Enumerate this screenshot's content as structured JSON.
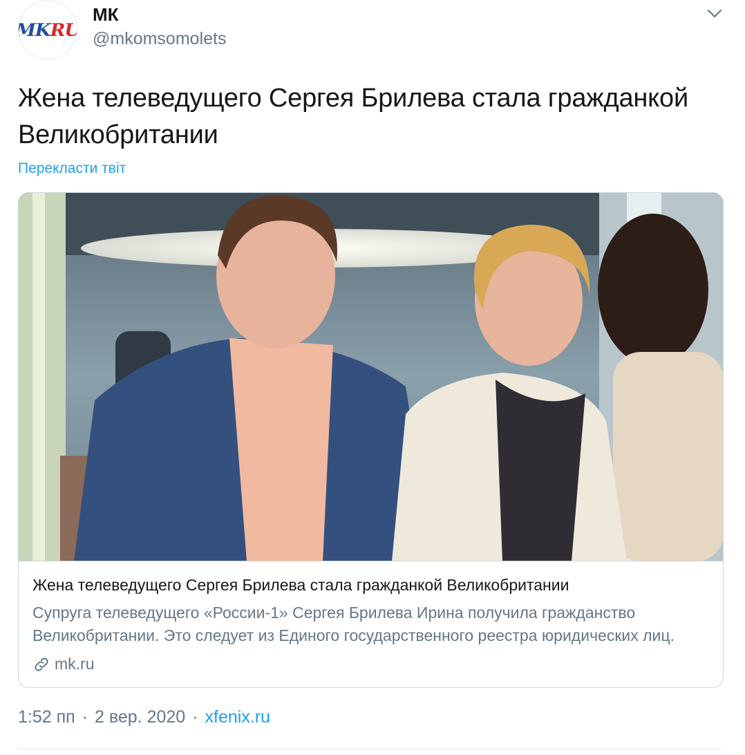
{
  "author": {
    "name": "МК",
    "handle": "@mkomsomolets",
    "logo_text_main": "MK",
    "logo_text_accent": "RU"
  },
  "tweet": {
    "text": "Жена телеведущего Сергея Брилева стала гражданкой Великобритании",
    "translate_label": "Перекласти твіт"
  },
  "card": {
    "title": "Жена телеведущего Сергея Брилева стала гражданкой Великобритании",
    "description": "Супруга телеведущего «России-1» Сергея Брилева Ирина получила гражданство Великобритании. Это следует из Единого государственного реестра юридических лиц.",
    "domain": "mk.ru"
  },
  "meta": {
    "time": "1:52 пп",
    "separator": "·",
    "date": "2 вер. 2020",
    "source": "xfenix.ru"
  },
  "icons": {
    "menu": "chevron-down-icon",
    "link": "link-icon"
  },
  "colors": {
    "accent": "#1da1f2",
    "secondary_text": "#657786",
    "primary_text": "#14171a",
    "logo_blue": "#1f4e9c",
    "logo_red": "#d9262b"
  }
}
